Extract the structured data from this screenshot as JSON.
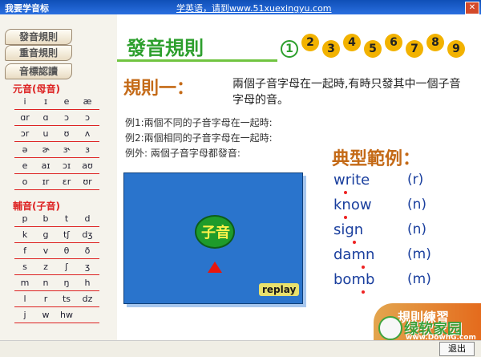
{
  "titlebar": {
    "app_title": "我要学音标",
    "center_link": "学英语，请到www.51xuexingyu.com",
    "close": "✕"
  },
  "sidebar": {
    "nav": [
      {
        "label": "發音規則"
      },
      {
        "label": "重音規則"
      },
      {
        "label": "音標認讀"
      }
    ],
    "vowel_title": "元音(母音)",
    "vowel_rows": [
      [
        "i",
        "ɪ",
        "e",
        "æ"
      ],
      [
        "ɑr",
        "ɑ",
        "ɔ",
        "ɔ"
      ],
      [
        "ɔr",
        "u",
        "ʊ",
        "ʌ"
      ],
      [
        "ə",
        "ɚ",
        "ɝ",
        "ɜ"
      ],
      [
        "e",
        "aɪ",
        "ɔɪ",
        "aʊ"
      ],
      [
        "o",
        "ɪr",
        "ɛr",
        "ʊr"
      ]
    ],
    "consonant_title": "輔音(子音)",
    "consonant_rows": [
      [
        "p",
        "b",
        "t",
        "d"
      ],
      [
        "k",
        "g",
        "tʃ",
        "dʒ"
      ],
      [
        "f",
        "v",
        "θ",
        "ð"
      ],
      [
        "s",
        "z",
        "ʃ",
        "ʒ"
      ],
      [
        "m",
        "n",
        "ŋ",
        "h"
      ],
      [
        "l",
        "r",
        "ts",
        "dz"
      ],
      [
        "j",
        "w",
        "hw",
        ""
      ]
    ]
  },
  "main": {
    "heading": "發音規則",
    "bullets": [
      "1",
      "2",
      "3",
      "4",
      "5",
      "6",
      "7",
      "8",
      "9"
    ],
    "rule_title": "規則一：",
    "rule_text": "兩個子音字母在一起時,有時只發其中一個子音字母的音。",
    "examples": [
      "例1:兩個不同的子音字母在一起時:",
      "例2:兩個相同的子音字母在一起時:",
      "例外: 兩個子音字母都發音:"
    ],
    "typical_title": "典型範例：",
    "words": [
      {
        "word": "write",
        "phon": "(r)"
      },
      {
        "word": "know",
        "phon": "(n)"
      },
      {
        "word": "sign",
        "phon": "(n)"
      },
      {
        "word": "damn",
        "phon": "(m)"
      },
      {
        "word": "bomb",
        "phon": "(m)"
      }
    ],
    "anim": {
      "ball_text": "子音",
      "replay": "replay"
    },
    "practice": {
      "label": "規則練習",
      "brand": "绿软家园",
      "brand_sub": "www.DownG.com"
    }
  },
  "statusbar": {
    "exit": "退出"
  }
}
